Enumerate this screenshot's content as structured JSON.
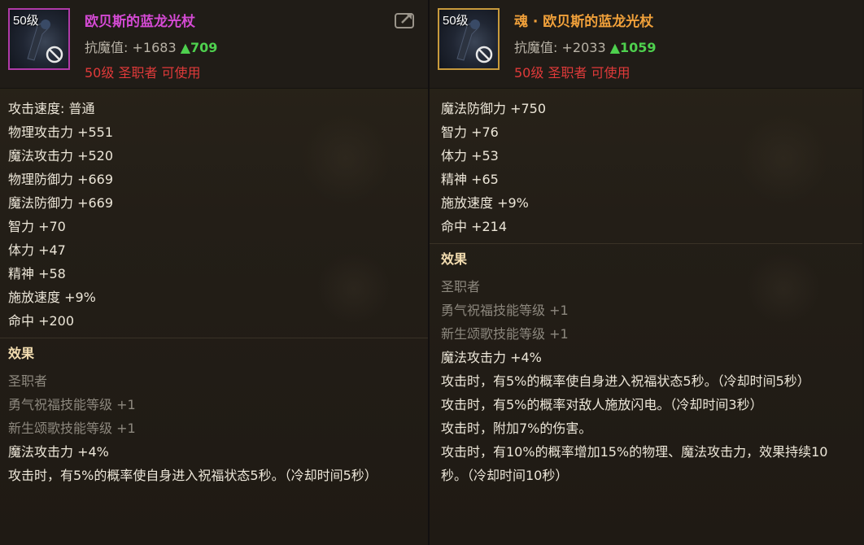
{
  "left": {
    "level_badge": "50级",
    "name": "欧贝斯的蓝龙光杖",
    "resist_label": "抗魔值:",
    "resist_value": "+1683",
    "resist_increase": "▲709",
    "requirement": "50级 圣职者 可使用",
    "stats": [
      "攻击速度: 普通",
      "物理攻击力 +551",
      "魔法攻击力 +520",
      "物理防御力 +669",
      "魔法防御力 +669",
      "智力 +70",
      "体力 +47",
      "精神 +58",
      "施放速度 +9%",
      "命中 +200"
    ],
    "effect_title": "效果",
    "effects": {
      "class_name": "圣职者",
      "skill1": "勇气祝福技能等级 +1",
      "skill2": "新生颂歌技能等级 +1",
      "magic_atk": "魔法攻击力 +4%",
      "proc1": "攻击时，有5%的概率使自身进入祝福状态5秒。（冷却时间5秒）"
    }
  },
  "right": {
    "level_badge": "50级",
    "name": "魂 · 欧贝斯的蓝龙光杖",
    "resist_label": "抗魔值:",
    "resist_value": "+2033",
    "resist_increase": "▲1059",
    "requirement": "50级 圣职者 可使用",
    "stats": [
      "魔法防御力 +750",
      "智力 +76",
      "体力 +53",
      "精神 +65",
      "施放速度 +9%",
      "命中 +214"
    ],
    "effect_title": "效果",
    "effects": {
      "class_name": "圣职者",
      "skill1": "勇气祝福技能等级 +1",
      "skill2": "新生颂歌技能等级 +1",
      "magic_atk": "魔法攻击力 +4%",
      "proc1": "攻击时，有5%的概率使自身进入祝福状态5秒。（冷却时间5秒）",
      "proc2": "攻击时，有5%的概率对敌人施放闪电。（冷却时间3秒）",
      "proc3": "攻击时，附加7%的伤害。",
      "proc4": "攻击时，有10%的概率增加15%的物理、魔法攻击力，效果持续10秒。（冷却时间10秒）"
    }
  },
  "colors": {
    "left_name": "#d44ad4",
    "right_name": "#f0a03a",
    "increase": "#4ed04e",
    "requirement": "#e03a3a",
    "section_title": "#f3ddb0"
  },
  "icons": {
    "item_icon": "staff-item-icon",
    "unusable": "no-entry-icon",
    "share": "share-export-icon"
  }
}
